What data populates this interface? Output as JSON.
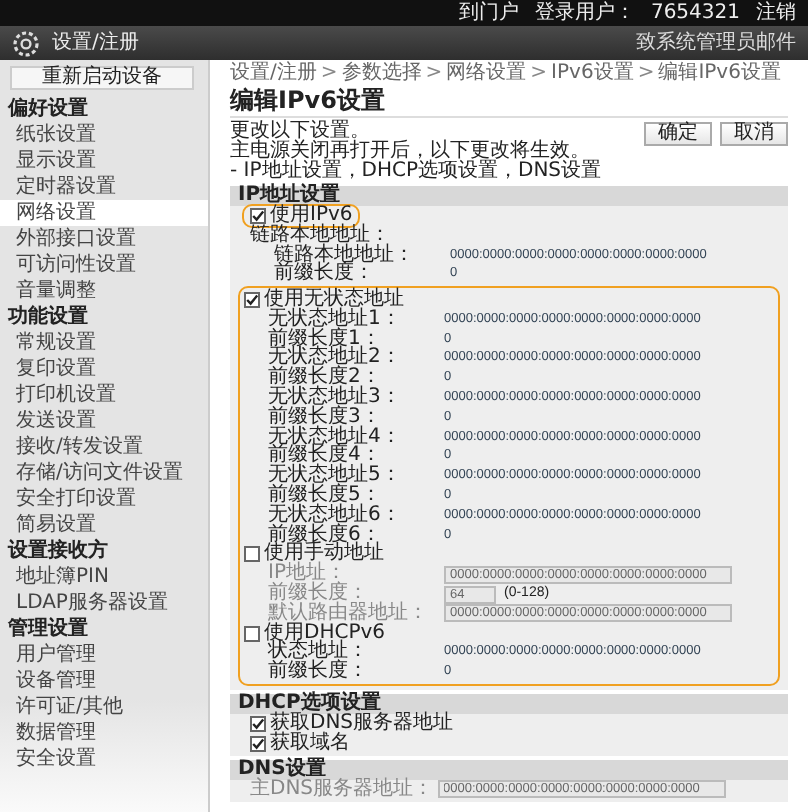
{
  "top_bar": {
    "links": [
      "到门户",
      "登录用户：",
      "7654321",
      "注销"
    ]
  },
  "header": {
    "title": "设置/注册",
    "mail_link": "致系统管理员邮件"
  },
  "sidebar": {
    "restart_button": "重新启动设备",
    "groups": [
      {
        "title": "偏好设置",
        "items": [
          {
            "label": "纸张设置",
            "selected": false
          },
          {
            "label": "显示设置",
            "selected": false
          },
          {
            "label": "定时器设置",
            "selected": false
          },
          {
            "label": "网络设置",
            "selected": true
          },
          {
            "label": "外部接口设置",
            "selected": false
          },
          {
            "label": "可访问性设置",
            "selected": false
          },
          {
            "label": "音量调整",
            "selected": false
          }
        ]
      },
      {
        "title": "功能设置",
        "items": [
          {
            "label": "常规设置",
            "selected": false
          },
          {
            "label": "复印设置",
            "selected": false
          },
          {
            "label": "打印机设置",
            "selected": false
          },
          {
            "label": "发送设置",
            "selected": false
          },
          {
            "label": "接收/转发设置",
            "selected": false
          },
          {
            "label": "存储/访问文件设置",
            "selected": false
          },
          {
            "label": "安全打印设置",
            "selected": false
          },
          {
            "label": "简易设置",
            "selected": false
          }
        ]
      },
      {
        "title": "设置接收方",
        "items": [
          {
            "label": "地址簿PIN",
            "selected": false
          },
          {
            "label": "LDAP服务器设置",
            "selected": false
          }
        ]
      },
      {
        "title": "管理设置",
        "items": [
          {
            "label": "用户管理",
            "selected": false
          },
          {
            "label": "设备管理",
            "selected": false
          },
          {
            "label": "许可证/其他",
            "selected": false
          },
          {
            "label": "数据管理",
            "selected": false
          },
          {
            "label": "安全设置",
            "selected": false
          }
        ]
      }
    ]
  },
  "breadcrumb": [
    "设置/注册",
    "参数选择",
    "网络设置",
    "IPv6设置",
    "编辑IPv6设置"
  ],
  "breadcrumb_separator": ">",
  "page_title": "编辑IPv6设置",
  "notes": [
    "更改以下设置。",
    "主电源关闭再打开后，以下更改将生效。",
    "- IP地址设置，DHCP选项设置，DNS设置"
  ],
  "buttons": [
    "确定",
    "取消"
  ],
  "sections": [
    {
      "title": "IP地址设置",
      "items": [
        {
          "kind": "checkbox",
          "label": "使用IPv6",
          "checked": true,
          "highlighted": true
        },
        {
          "kind": "heading",
          "label": "链路本地地址：",
          "items": [
            {
              "kind": "pair",
              "label": "链路本地地址：",
              "value": "0000:0000:0000:0000:0000:0000:0000:0000"
            },
            {
              "kind": "pair",
              "label": "前缀长度：",
              "value": "0"
            }
          ]
        },
        {
          "kind": "frame",
          "items": [
            {
              "kind": "checkbox",
              "label": "使用无状态地址",
              "checked": true,
              "items": [
                {
                  "kind": "pair",
                  "label": "无状态地址1：",
                  "value": "0000:0000:0000:0000:0000:0000:0000:0000"
                },
                {
                  "kind": "pair",
                  "label": "前缀长度1：",
                  "value": "0"
                },
                {
                  "kind": "pair",
                  "label": "无状态地址2：",
                  "value": "0000:0000:0000:0000:0000:0000:0000:0000"
                },
                {
                  "kind": "pair",
                  "label": "前缀长度2：",
                  "value": "0"
                },
                {
                  "kind": "pair",
                  "label": "无状态地址3：",
                  "value": "0000:0000:0000:0000:0000:0000:0000:0000"
                },
                {
                  "kind": "pair",
                  "label": "前缀长度3：",
                  "value": "0"
                },
                {
                  "kind": "pair",
                  "label": "无状态地址4：",
                  "value": "0000:0000:0000:0000:0000:0000:0000:0000"
                },
                {
                  "kind": "pair",
                  "label": "前缀长度4：",
                  "value": "0"
                },
                {
                  "kind": "pair",
                  "label": "无状态地址5：",
                  "value": "0000:0000:0000:0000:0000:0000:0000:0000"
                },
                {
                  "kind": "pair",
                  "label": "前缀长度5：",
                  "value": "0"
                },
                {
                  "kind": "pair",
                  "label": "无状态地址6：",
                  "value": "0000:0000:0000:0000:0000:0000:0000:0000"
                },
                {
                  "kind": "pair",
                  "label": "前缀长度6：",
                  "value": "0"
                }
              ]
            },
            {
              "kind": "checkbox",
              "label": "使用手动地址",
              "checked": false,
              "items": [
                {
                  "kind": "input",
                  "label": "IP地址：",
                  "value": "0000:0000:0000:0000:0000:0000:0000:0000",
                  "disabled": true
                },
                {
                  "kind": "input",
                  "label": "前缀长度：",
                  "value": "64",
                  "hint": "(0-128)",
                  "disabled": true
                },
                {
                  "kind": "input",
                  "label": "默认路由器地址：",
                  "value": "0000:0000:0000:0000:0000:0000:0000:0000",
                  "disabled": true
                }
              ]
            },
            {
              "kind": "checkbox",
              "label": "使用DHCPv6",
              "checked": false,
              "items": [
                {
                  "kind": "pair",
                  "label": "状态地址：",
                  "value": "0000:0000:0000:0000:0000:0000:0000:0000"
                },
                {
                  "kind": "pair",
                  "label": "前缀长度：",
                  "value": "0"
                }
              ]
            }
          ]
        }
      ]
    },
    {
      "title": "DHCP选项设置",
      "items": [
        {
          "kind": "checkbox",
          "label": "获取DNS服务器地址",
          "checked": true
        },
        {
          "kind": "checkbox",
          "label": "获取域名",
          "checked": true
        }
      ]
    },
    {
      "title": "DNS设置",
      "items": [
        {
          "kind": "input",
          "label": "主DNS服务器地址：",
          "value": "0000:0000:0000:0000:0000:0000:0000:0000",
          "disabled": true
        }
      ]
    }
  ]
}
